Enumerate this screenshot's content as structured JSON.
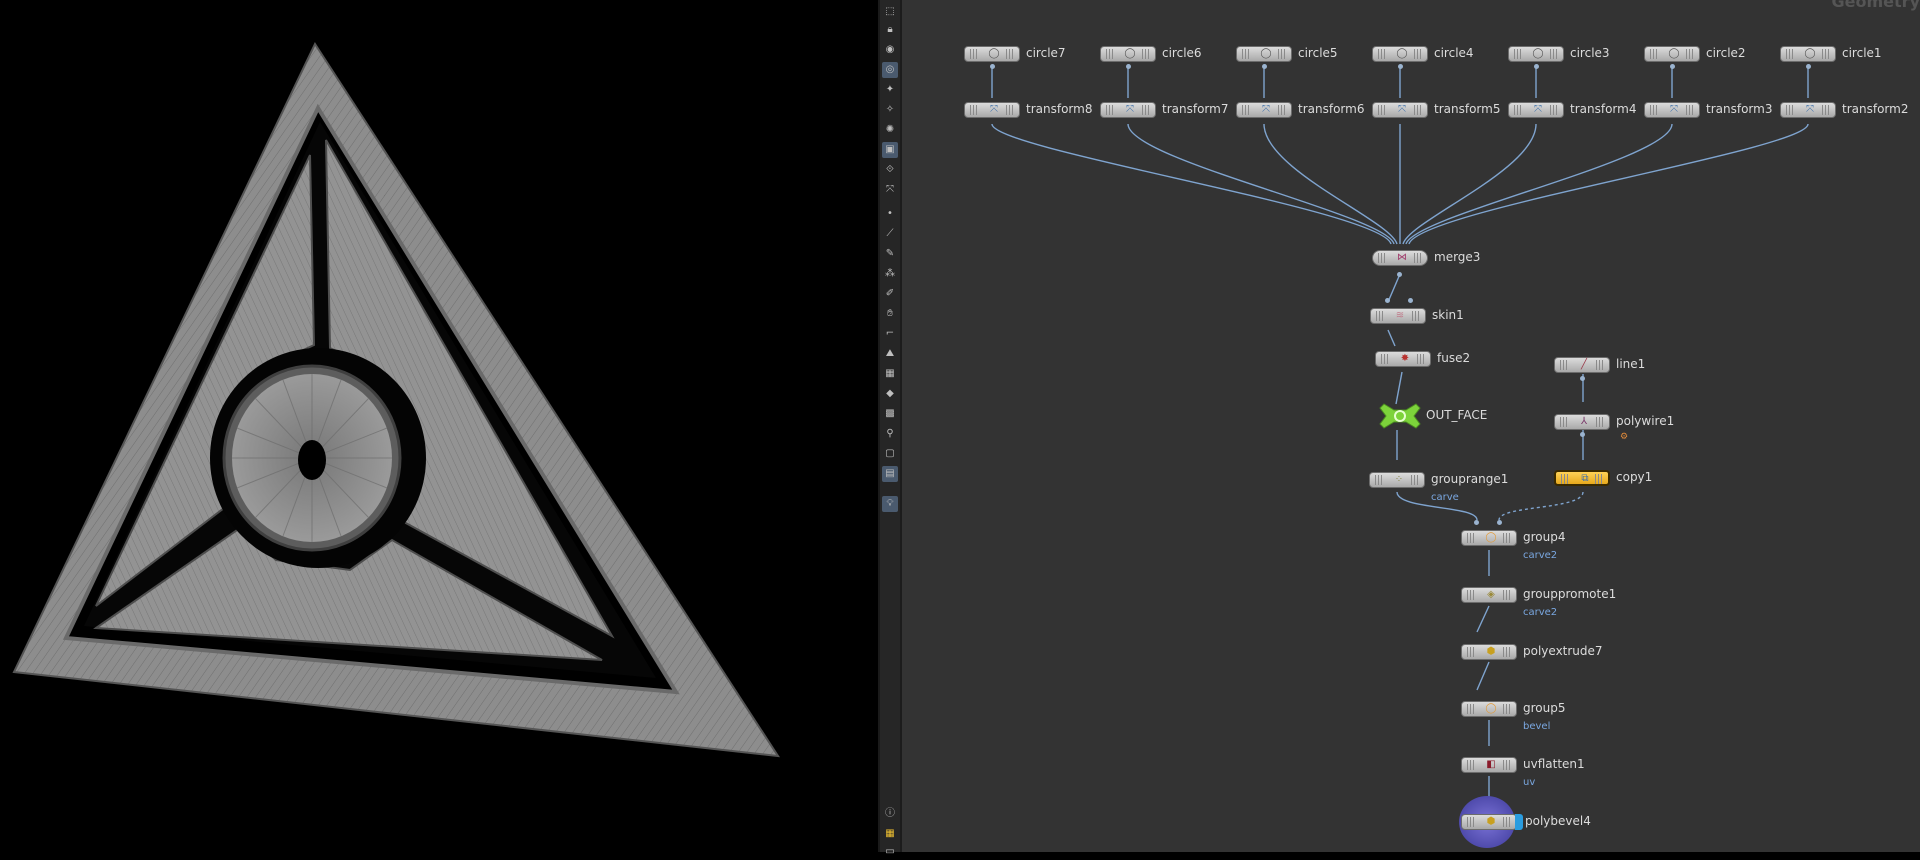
{
  "network": {
    "corner_title": "Geometry",
    "nodes": {
      "circle7": {
        "label": "circle7"
      },
      "circle6": {
        "label": "circle6"
      },
      "circle5": {
        "label": "circle5"
      },
      "circle4": {
        "label": "circle4"
      },
      "circle3": {
        "label": "circle3"
      },
      "circle2": {
        "label": "circle2"
      },
      "circle1": {
        "label": "circle1"
      },
      "transform8": {
        "label": "transform8"
      },
      "transform7": {
        "label": "transform7"
      },
      "transform6": {
        "label": "transform6"
      },
      "transform5": {
        "label": "transform5"
      },
      "transform4": {
        "label": "transform4"
      },
      "transform3": {
        "label": "transform3"
      },
      "transform2": {
        "label": "transform2"
      },
      "merge3": {
        "label": "merge3"
      },
      "skin1": {
        "label": "skin1"
      },
      "fuse2": {
        "label": "fuse2"
      },
      "line1": {
        "label": "line1"
      },
      "OUT_FACE": {
        "label": "OUT_FACE"
      },
      "polywire1": {
        "label": "polywire1"
      },
      "grouprange1": {
        "label": "grouprange1",
        "group": "carve"
      },
      "copy1": {
        "label": "copy1"
      },
      "group4": {
        "label": "group4",
        "group": "carve2"
      },
      "grouppromote1": {
        "label": "grouppromote1",
        "group": "carve2"
      },
      "polyextrude7": {
        "label": "polyextrude7"
      },
      "group5": {
        "label": "group5",
        "group": "bevel"
      },
      "uvflatten1": {
        "label": "uvflatten1",
        "group": "uv"
      },
      "polybevel4": {
        "label": "polybevel4"
      }
    }
  },
  "toolbar": {
    "icons": [
      "select-icon",
      "lock-icon",
      "visibility-icon",
      "camera-icon",
      "light-icon",
      "light-icon-2",
      "snapshot-icon",
      "display-icon",
      "handle-icon",
      "transform-icon",
      "point-icon",
      "edge-icon",
      "brush-icon",
      "vertex-icon",
      "paint-icon",
      "sculpt-icon",
      "measure-icon",
      "terrain-icon",
      "grid-icon",
      "snap-icon",
      "uv-icon",
      "pin-icon",
      "box-icon",
      "render-icon",
      "light-bulb-icon",
      "info-icon",
      "layout-icon",
      "bottom-icon"
    ]
  },
  "colors": {
    "viewport_bg": "#000000",
    "network_bg": "#333333",
    "wire": "#7fa4cf",
    "selected_node": "#f2b92b",
    "output_node": "#7dd33b",
    "group_text": "#7aa7e0"
  }
}
